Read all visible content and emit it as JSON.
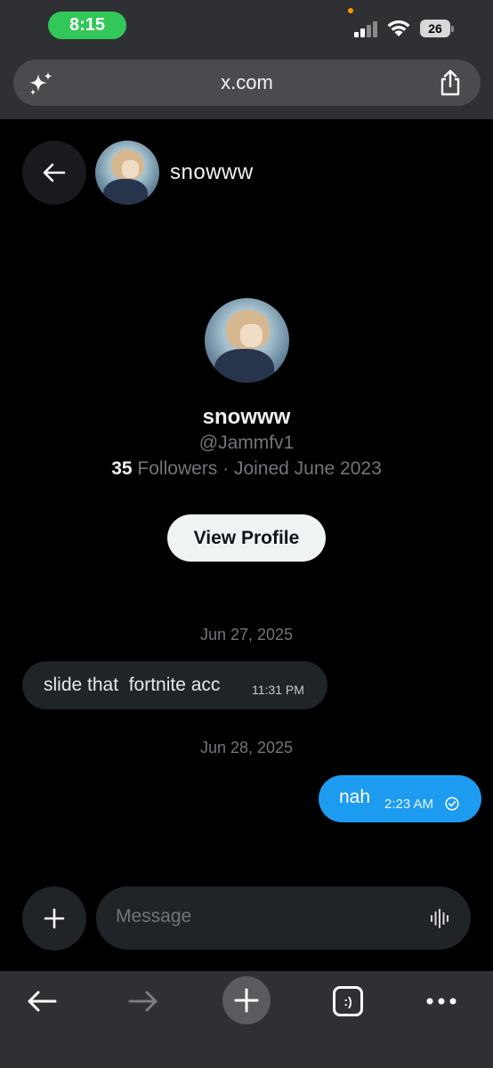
{
  "status_bar": {
    "time": "8:15",
    "battery": "26"
  },
  "browser": {
    "url": "x.com"
  },
  "header": {
    "name": "snowww"
  },
  "profile": {
    "name": "snowww",
    "handle": "@Jammfv1",
    "followers_count": "35",
    "followers_label": "Followers",
    "joined": "· Joined June 2023",
    "view_profile_label": "View Profile"
  },
  "messages": [
    {
      "date": "Jun 27, 2025",
      "direction": "incoming",
      "text": "slide that  fortnite acc",
      "time": "11:31 PM"
    },
    {
      "date": "Jun 28, 2025",
      "direction": "outgoing",
      "text": "nah",
      "time": "2:23 AM"
    }
  ],
  "composer": {
    "placeholder": "Message"
  },
  "toolbar": {
    "tabs_label": ":)"
  },
  "colors": {
    "accent": "#1d9bf0",
    "time_pill": "#32c759",
    "incoming_bubble": "#202327"
  },
  "icons": [
    "sparkle-icon",
    "share-icon",
    "back-arrow-icon",
    "check-circle-icon",
    "plus-icon",
    "voice-wave-icon",
    "forward-arrow-icon",
    "tabs-icon",
    "more-icon"
  ]
}
